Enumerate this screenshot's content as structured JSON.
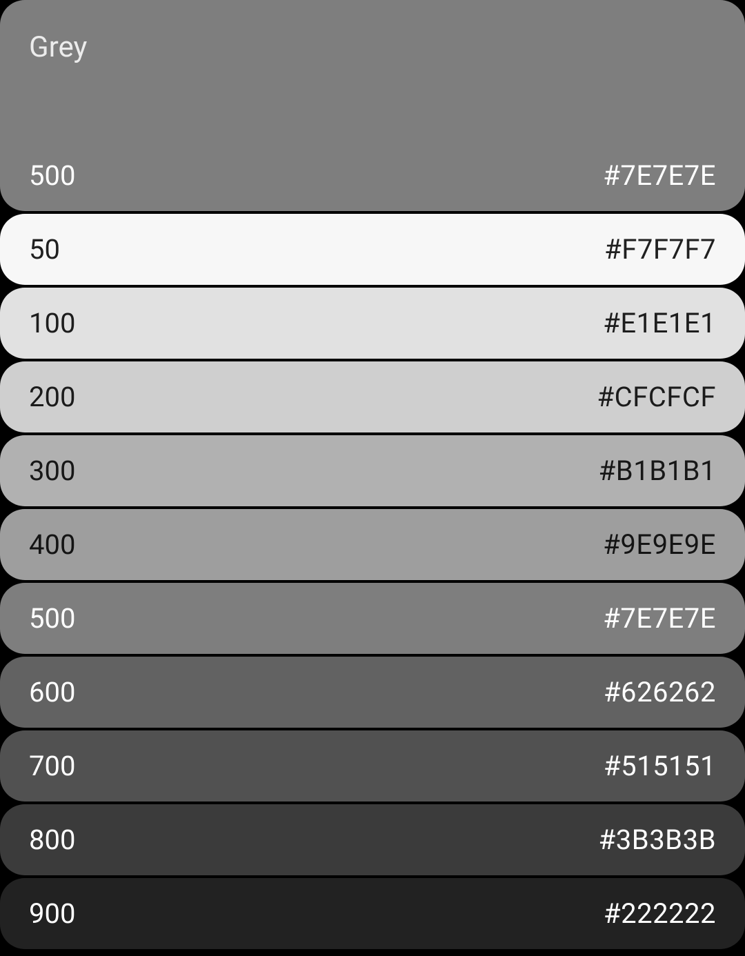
{
  "palette": {
    "name": "Grey",
    "header": {
      "bg": "#7E7E7E",
      "textClass": "text-light",
      "titleClass": "muted-light",
      "shade_label": "500",
      "hex": "#7E7E7E"
    },
    "swatches": [
      {
        "shade": "50",
        "hex": "#F7F7F7",
        "bg": "#F7F7F7",
        "textClass": "text-dark"
      },
      {
        "shade": "100",
        "hex": "#E1E1E1",
        "bg": "#E1E1E1",
        "textClass": "text-dark"
      },
      {
        "shade": "200",
        "hex": "#CFCFCF",
        "bg": "#CFCFCF",
        "textClass": "text-dark"
      },
      {
        "shade": "300",
        "hex": "#B1B1B1",
        "bg": "#B1B1B1",
        "textClass": "text-dark"
      },
      {
        "shade": "400",
        "hex": "#9E9E9E",
        "bg": "#9E9E9E",
        "textClass": "text-dark"
      },
      {
        "shade": "500",
        "hex": "#7E7E7E",
        "bg": "#7E7E7E",
        "textClass": "text-light"
      },
      {
        "shade": "600",
        "hex": "#626262",
        "bg": "#626262",
        "textClass": "text-light"
      },
      {
        "shade": "700",
        "hex": "#515151",
        "bg": "#515151",
        "textClass": "text-light"
      },
      {
        "shade": "800",
        "hex": "#3B3B3B",
        "bg": "#3B3B3B",
        "textClass": "text-light"
      },
      {
        "shade": "900",
        "hex": "#222222",
        "bg": "#222222",
        "textClass": "text-light"
      }
    ]
  }
}
